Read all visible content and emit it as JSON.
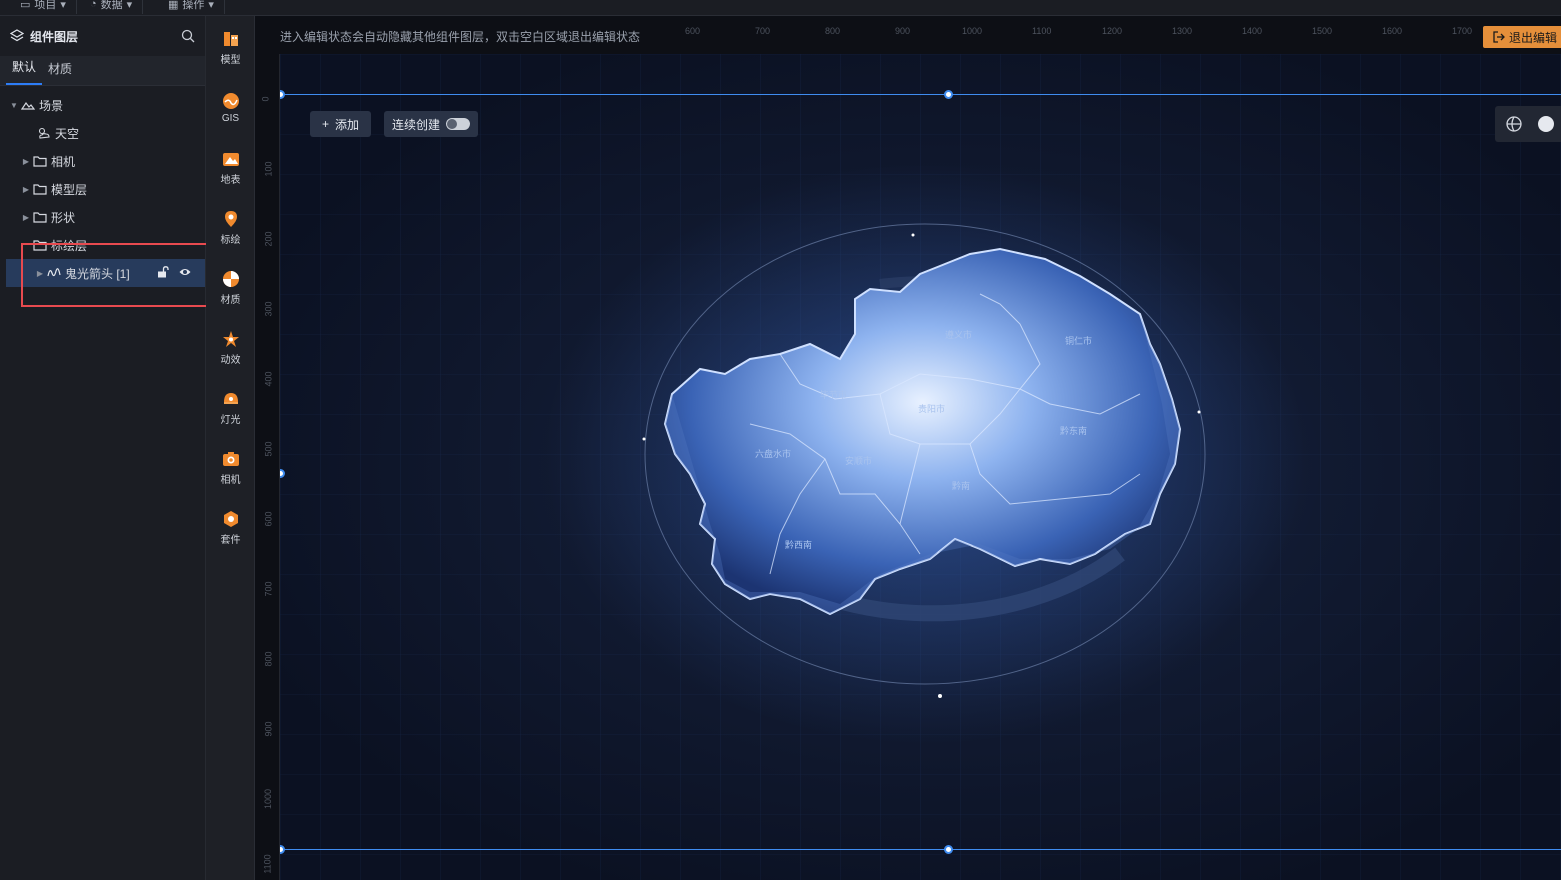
{
  "topbar": {
    "tabs": [
      "项目",
      "数据",
      "操作"
    ]
  },
  "left_panel": {
    "title": "组件图层",
    "tabs": [
      "默认",
      "材质"
    ],
    "tree": {
      "scene": "场景",
      "sky": "天空",
      "camera": "相机",
      "model_layer": "模型层",
      "shape": "形状",
      "plot_layer": "标绘层",
      "selected_item": "鬼光箭头 [1]"
    }
  },
  "toolbar": {
    "items": [
      "模型",
      "GIS",
      "地表",
      "标绘",
      "材质",
      "动效",
      "灯光",
      "相机",
      "套件"
    ]
  },
  "editor": {
    "hint": "进入编辑状态会自动隐藏其他组件图层，双击空白区域退出编辑状态",
    "exit_label": "退出编辑",
    "ruler_top": [
      "600",
      "700",
      "800",
      "900",
      "1000",
      "1100",
      "1200",
      "1300",
      "1400",
      "1500",
      "1600",
      "1700"
    ],
    "ruler_left": [
      "0",
      "100",
      "200",
      "300",
      "400",
      "500",
      "600",
      "700",
      "800",
      "900",
      "1000",
      "1100"
    ],
    "add_label": "添加",
    "continuous_label": "连续创建"
  },
  "map": {
    "cities": [
      "遵义市",
      "铜仁市",
      "毕节市",
      "贵阳市",
      "黔东南",
      "六盘水市",
      "安顺市",
      "黔南",
      "黔西南"
    ]
  }
}
